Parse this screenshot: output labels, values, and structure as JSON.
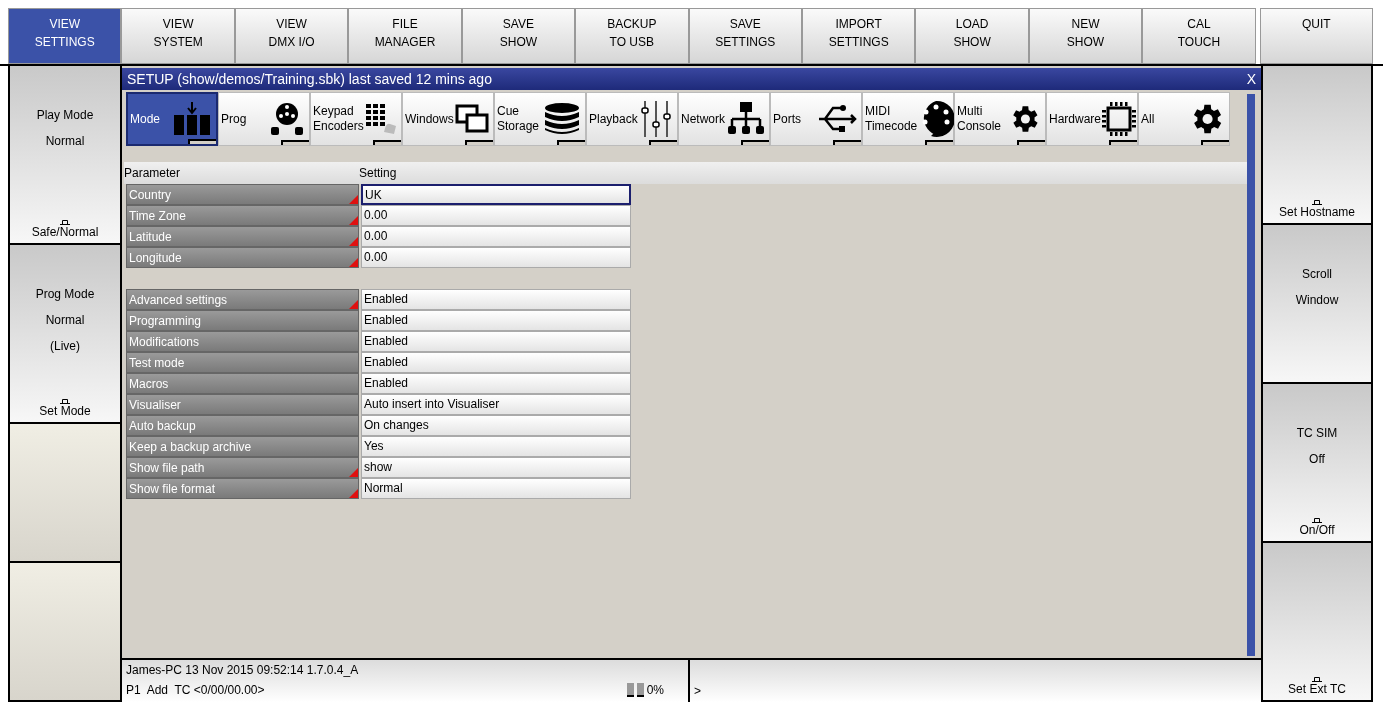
{
  "top_buttons": [
    {
      "lines": [
        "VIEW",
        "SETTINGS"
      ],
      "selected": true
    },
    {
      "lines": [
        "VIEW",
        "SYSTEM"
      ],
      "selected": false
    },
    {
      "lines": [
        "VIEW",
        "DMX I/O"
      ],
      "selected": false
    },
    {
      "lines": [
        "FILE",
        "MANAGER"
      ],
      "selected": false
    },
    {
      "lines": [
        "SAVE",
        "SHOW"
      ],
      "selected": false
    },
    {
      "lines": [
        "BACKUP",
        "TO USB"
      ],
      "selected": false
    },
    {
      "lines": [
        "SAVE",
        "SETTINGS"
      ],
      "selected": false
    },
    {
      "lines": [
        "IMPORT",
        "SETTINGS"
      ],
      "selected": false
    },
    {
      "lines": [
        "LOAD",
        "SHOW"
      ],
      "selected": false
    },
    {
      "lines": [
        "NEW",
        "SHOW"
      ],
      "selected": false
    },
    {
      "lines": [
        "CAL",
        "TOUCH"
      ],
      "selected": false
    },
    {
      "lines": [
        "QUIT"
      ],
      "selected": false
    }
  ],
  "left_keys": [
    {
      "kind": "labelled",
      "lines": [
        "Play Mode",
        "Normal"
      ],
      "footer": "Safe/Normal"
    },
    {
      "kind": "labelled",
      "lines": [
        "Prog Mode",
        "Normal",
        "(Live)"
      ],
      "footer": "Set Mode"
    },
    {
      "kind": "blank"
    },
    {
      "kind": "blank"
    }
  ],
  "right_keys": [
    {
      "kind": "labelled",
      "footer": "Set Hostname"
    },
    {
      "kind": "labelled",
      "lines": [
        "Scroll",
        "Window"
      ]
    },
    {
      "kind": "labelled",
      "lines": [
        "TC SIM",
        "Off"
      ],
      "footer": "On/Off"
    },
    {
      "kind": "labelled",
      "footer": "Set Ext TC"
    }
  ],
  "window": {
    "title": "SETUP (show/demos/Training.sbk) last saved 12 mins ago",
    "close": "X"
  },
  "tabs": [
    {
      "lines": [
        "Mode"
      ],
      "selected": true
    },
    {
      "lines": [
        "Prog"
      ],
      "selected": false
    },
    {
      "lines": [
        "Keypad",
        "Encoders"
      ],
      "selected": false
    },
    {
      "lines": [
        "Windows"
      ],
      "selected": false
    },
    {
      "lines": [
        "Cue",
        "Storage"
      ],
      "selected": false
    },
    {
      "lines": [
        "Playback"
      ],
      "selected": false
    },
    {
      "lines": [
        "Network"
      ],
      "selected": false
    },
    {
      "lines": [
        "Ports"
      ],
      "selected": false
    },
    {
      "lines": [
        "MIDI",
        "Timecode"
      ],
      "selected": false
    },
    {
      "lines": [
        "Multi",
        "Console"
      ],
      "selected": false
    },
    {
      "lines": [
        "Hardware"
      ],
      "selected": false
    },
    {
      "lines": [
        "All"
      ],
      "selected": false
    }
  ],
  "table": {
    "columns": [
      "Parameter",
      "Setting"
    ],
    "groups": [
      {
        "rows": [
          {
            "parameter": "Country",
            "setting": "UK",
            "flagged": true,
            "focused": true
          },
          {
            "parameter": "Time Zone",
            "setting": "0.00",
            "flagged": true,
            "focused": false
          },
          {
            "parameter": "Latitude",
            "setting": "0.00",
            "flagged": true,
            "focused": false
          },
          {
            "parameter": "Longitude",
            "setting": "0.00",
            "flagged": true,
            "focused": false
          }
        ]
      },
      {
        "rows": [
          {
            "parameter": "Advanced settings",
            "setting": "Enabled",
            "flagged": true,
            "focused": false
          },
          {
            "parameter": "Programming",
            "setting": "Enabled",
            "flagged": false,
            "focused": false
          },
          {
            "parameter": "Modifications",
            "setting": "Enabled",
            "flagged": false,
            "focused": false
          },
          {
            "parameter": "Test mode",
            "setting": "Enabled",
            "flagged": false,
            "focused": false
          },
          {
            "parameter": "Macros",
            "setting": "Enabled",
            "flagged": false,
            "focused": false
          },
          {
            "parameter": "Visualiser",
            "setting": "Auto insert into Visualiser",
            "flagged": false,
            "focused": false
          },
          {
            "parameter": "Auto backup",
            "setting": "On changes",
            "flagged": false,
            "focused": false
          },
          {
            "parameter": "Keep a backup archive",
            "setting": "Yes",
            "flagged": false,
            "focused": false
          },
          {
            "parameter": "Show file path",
            "setting": "show",
            "flagged": true,
            "focused": false
          },
          {
            "parameter": "Show file format",
            "setting": "Normal",
            "flagged": true,
            "focused": false
          }
        ]
      }
    ]
  },
  "status_bar": {
    "info": "James-PC 13 Nov 2015 09:52:14 1.7.0.4_A",
    "command": "P1  Add  TC <0/00/00.00>",
    "usage": "0%"
  },
  "command_line": {
    "prompt": ">"
  }
}
